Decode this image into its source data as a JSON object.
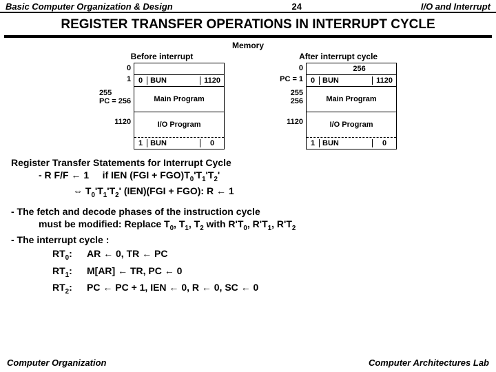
{
  "header": {
    "left": "Basic Computer Organization & Design",
    "page": "24",
    "right": "I/O and Interrupt"
  },
  "title": "REGISTER  TRANSFER  OPERATIONS  IN  INTERRUPT CYCLE",
  "memlabel": "Memory",
  "before": {
    "cap": "Before interrupt",
    "addr0": "0",
    "addr1": "1",
    "addr255": "255",
    "addrpc": "PC = 256",
    "addr1120": "1120",
    "r1c1": "0",
    "r1c2": "BUN",
    "r1c3": "1120",
    "main": "Main Program",
    "io": "I/O Program",
    "lastc1": "1",
    "lastc2": "BUN",
    "lastc3": "0"
  },
  "after": {
    "cap": "After interrupt cycle",
    "addr0": "0",
    "v0": "256",
    "addr1": "PC = 1",
    "addr255": "255",
    "addr256": "256",
    "addr1120": "1120",
    "r1c1": "0",
    "r1c2": "BUN",
    "r1c3": "1120",
    "main": "Main Program",
    "io": "I/O Program",
    "lastc1": "1",
    "lastc2": "BUN",
    "lastc3": "0"
  },
  "stmt": {
    "h": "Register Transfer Statements for Interrupt Cycle",
    "l1a": "- R  F/F ← 1",
    "l1b": "if IEN (FGI + FGO)T",
    "l2": "⇔ T",
    "l2b": "(IEN)(FGI + FGO):   R ← 1"
  },
  "para1": "- The fetch and decode phases of the instruction cycle",
  "para1b": "must be modified: Replace T",
  "para1c": " with  R'T",
  "para2": "- The interrupt cycle :",
  "ops": {
    "rt0": "RT",
    "rt0v": "AR ← 0,  TR ← PC",
    "rt1": "RT",
    "rt1v": "M[AR] ← TR,  PC ← 0",
    "rt2": "RT",
    "rt2v": "PC ← PC + 1,  IEN ← 0,  R ← 0,  SC ← 0"
  },
  "footer": {
    "left": "Computer Organization",
    "right": "Computer Architectures Lab"
  }
}
